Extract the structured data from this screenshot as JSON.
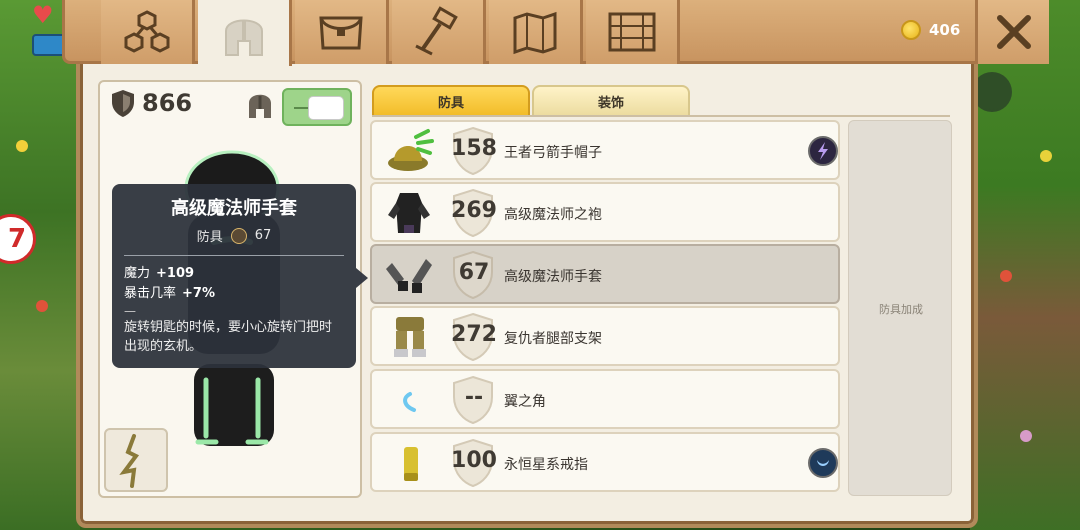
{
  "hud": {
    "coins": "406",
    "badge_text": "7"
  },
  "tabs": [
    {
      "name": "tab-team",
      "icon": "team-icon"
    },
    {
      "name": "tab-equipment",
      "icon": "helmet-icon",
      "active": true
    },
    {
      "name": "tab-bag",
      "icon": "bag-icon"
    },
    {
      "name": "tab-crafting",
      "icon": "hammer-icon"
    },
    {
      "name": "tab-map",
      "icon": "map-icon"
    },
    {
      "name": "tab-storage",
      "icon": "chest-icon"
    }
  ],
  "left": {
    "armor_total": "866",
    "toggle_on": true
  },
  "tooltip": {
    "title": "高级魔法师手套",
    "type": "防具",
    "armor": "67",
    "stats": [
      {
        "label": "魔力",
        "value": "+109"
      },
      {
        "label": "暴击几率",
        "value": "+7%"
      }
    ],
    "dash": "—",
    "description": "旋转钥匙的时候，要小心旋转门把时出现的玄机。"
  },
  "categories": {
    "armor": "防具",
    "decoration": "装饰"
  },
  "items": [
    {
      "armor": "158",
      "name": "王者弓箭手帽子",
      "gem": "lightning-gem-icon"
    },
    {
      "armor": "269",
      "name": "高级魔法师之袍",
      "gem": ""
    },
    {
      "armor": "67",
      "name": "高级魔法师手套",
      "gem": "",
      "selected": true
    },
    {
      "armor": "272",
      "name": "复仇者腿部支架",
      "gem": ""
    },
    {
      "armor": "--",
      "name": "翼之角",
      "gem": ""
    },
    {
      "armor": "100",
      "name": "永恒星系戒指",
      "gem": "moon-gem-icon"
    }
  ],
  "bonus": {
    "label": "防具加成"
  },
  "colors": {
    "accent": "#f2bd2a",
    "panel": "#f3eee2",
    "frame": "#b18a5a"
  }
}
